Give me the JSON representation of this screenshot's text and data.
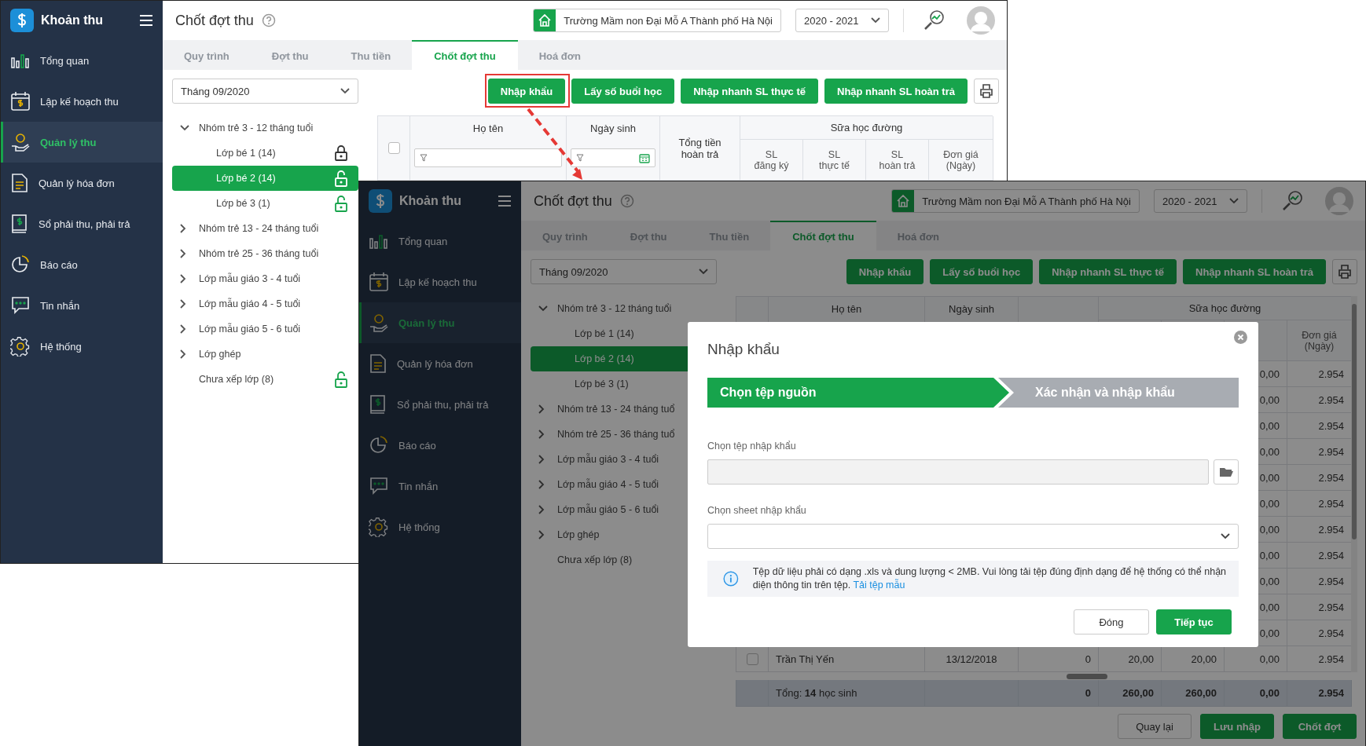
{
  "back_screen": {
    "app_name": "Khoản thu",
    "sidebar": [
      {
        "label": "Tổng quan",
        "selected": false
      },
      {
        "label": "Lập kế hoạch thu",
        "selected": false
      },
      {
        "label": "Quản lý thu",
        "selected": true
      },
      {
        "label": "Quản lý hóa đơn",
        "selected": false
      },
      {
        "label": "Sổ phải thu, phải trả",
        "selected": false
      },
      {
        "label": "Báo cáo",
        "selected": false
      },
      {
        "label": "Tin nhắn",
        "selected": false
      },
      {
        "label": "Hệ thống",
        "selected": false
      }
    ],
    "header": {
      "title": "Chốt đợt thu",
      "school": "Trường Mầm non Đại Mỗ A Thành phố Hà Nội",
      "year": "2020 - 2021"
    },
    "tabs": [
      {
        "label": "Quy trình",
        "selected": false
      },
      {
        "label": "Đợt thu",
        "selected": false
      },
      {
        "label": "Thu tiền",
        "selected": false
      },
      {
        "label": "Chốt đợt thu",
        "selected": true
      },
      {
        "label": "Hoá đơn",
        "selected": false
      }
    ],
    "month_select": "Tháng 09/2020",
    "toolbar_buttons": [
      "Nhập khẩu",
      "Lấy số buổi học",
      "Nhập nhanh SL thực tế",
      "Nhập nhanh SL hoàn trả"
    ],
    "tree": [
      {
        "label": "Nhóm trẻ 3 - 12 tháng tuổi",
        "expanded": true,
        "selected": false,
        "children": [
          {
            "label": "Lớp bé 1 (14)",
            "selected": false,
            "locked": true
          },
          {
            "label": "Lớp bé 2 (14)",
            "selected": true,
            "locked": false
          },
          {
            "label": "Lớp bé 3 (1)",
            "selected": false,
            "locked": false
          }
        ]
      },
      {
        "label": "Nhóm trẻ 13 - 24 tháng tuổi",
        "expanded": false,
        "selected": false
      },
      {
        "label": "Nhóm trẻ 25 - 36 tháng tuổi",
        "expanded": false,
        "selected": false
      },
      {
        "label": "Lớp mẫu giáo 3 - 4 tuổi",
        "expanded": false,
        "selected": false
      },
      {
        "label": "Lớp mẫu giáo 4 - 5 tuổi",
        "expanded": false,
        "selected": false
      },
      {
        "label": "Lớp mẫu giáo 5 - 6 tuổi",
        "expanded": false,
        "selected": false
      },
      {
        "label": "Lớp ghép",
        "expanded": false,
        "selected": false
      },
      {
        "label": "Chưa xếp lớp (8)",
        "selected": false,
        "locked": false
      }
    ],
    "table": {
      "select_all": {
        "checked": false
      },
      "filter_row": true,
      "header": {
        "ho_ten": "Họ tên",
        "ngay_sinh": "Ngày sinh",
        "tong_tien": "Tổng tiền\nhoàn trả",
        "group": "Sữa học đường",
        "sl_dang_ky": "SL\nđăng ký",
        "sl_thuc_te": "SL\nthực tế",
        "sl_hoan_tra": "SL\nhoàn trả",
        "don_gia": "Đơn giá\n(Ngày)"
      }
    }
  },
  "front_screen": {
    "app_name": "Khoản thu",
    "sidebar": [
      {
        "label": "Tổng quan",
        "selected": false
      },
      {
        "label": "Lập kế hoạch thu",
        "selected": false
      },
      {
        "label": "Quản lý thu",
        "selected": true
      },
      {
        "label": "Quản lý hóa đơn",
        "selected": false
      },
      {
        "label": "Sổ phải thu, phải trả",
        "selected": false
      },
      {
        "label": "Báo cáo",
        "selected": false
      },
      {
        "label": "Tin nhắn",
        "selected": false
      },
      {
        "label": "Hệ thống",
        "selected": false
      }
    ],
    "header": {
      "title": "Chốt đợt thu",
      "school": "Trường Mầm non Đại Mỗ A Thành phố Hà Nội",
      "year": "2020 - 2021"
    },
    "tabs": [
      {
        "label": "Quy trình",
        "selected": false
      },
      {
        "label": "Đợt thu",
        "selected": false
      },
      {
        "label": "Thu tiền",
        "selected": false
      },
      {
        "label": "Chốt đợt thu",
        "selected": true
      },
      {
        "label": "Hoá đơn",
        "selected": false
      }
    ],
    "month_select": "Tháng 09/2020",
    "toolbar_buttons": [
      "Nhập khẩu",
      "Lấy số buổi học",
      "Nhập nhanh SL thực tế",
      "Nhập nhanh SL hoàn trả"
    ],
    "tree": [
      {
        "label": "Nhóm trẻ 3 - 12 tháng tuổi",
        "expanded": true,
        "selected": false,
        "children": [
          {
            "label": "Lớp bé 1 (14)",
            "selected": false
          },
          {
            "label": "Lớp bé 2 (14)",
            "selected": true
          },
          {
            "label": "Lớp bé 3 (1)",
            "selected": false
          }
        ]
      },
      {
        "label": "Nhóm trẻ 13 - 24 tháng tuổ",
        "expanded": false,
        "selected": false
      },
      {
        "label": "Nhóm trẻ 25 - 36 tháng tuổ",
        "expanded": false,
        "selected": false
      },
      {
        "label": "Lớp mẫu giáo 3 - 4 tuổi",
        "expanded": false,
        "selected": false
      },
      {
        "label": "Lớp mẫu giáo 4 - 5 tuổi",
        "expanded": false,
        "selected": false
      },
      {
        "label": "Lớp mẫu giáo 5 - 6 tuổi",
        "expanded": false,
        "selected": false
      },
      {
        "label": "Lớp ghép",
        "expanded": false,
        "selected": false
      },
      {
        "label": "Chưa xếp lớp (8)",
        "selected": false
      }
    ],
    "table": {
      "header": {
        "ho_ten": "Họ tên",
        "ngay_sinh": "Ngày sinh",
        "group": "Sữa học đường",
        "don_gia": "Đơn giá\n(Ngày)"
      },
      "rows": [
        {
          "sl_hoan_tra": "0,00",
          "don_gia": "2.954"
        },
        {
          "sl_hoan_tra": "0,00",
          "don_gia": "2.954"
        },
        {
          "sl_hoan_tra": "0,00",
          "don_gia": "2.954"
        },
        {
          "sl_hoan_tra": "0,00",
          "don_gia": "2.954"
        },
        {
          "sl_hoan_tra": "0,00",
          "don_gia": "2.954"
        },
        {
          "sl_hoan_tra": "0,00",
          "don_gia": "2.954"
        },
        {
          "sl_hoan_tra": "0,00",
          "don_gia": "2.954"
        },
        {
          "sl_hoan_tra": "0,00",
          "don_gia": "2.954"
        },
        {
          "sl_hoan_tra": "0,00",
          "don_gia": "2.954"
        },
        {
          "sl_hoan_tra": "0,00",
          "don_gia": "2.954"
        },
        {
          "sl_hoan_tra": "0,00",
          "don_gia": "2.954"
        },
        {
          "checked": false,
          "ho_ten": "Trần Thị Yến",
          "ngay_sinh": "13/12/2018",
          "tong_tien": "0",
          "sl_dang_ky": "20,00",
          "sl_thuc_te": "20,00",
          "sl_hoan_tra": "0,00",
          "don_gia": "2.954"
        }
      ],
      "footer": {
        "label": "Tổng: **14** học sinh",
        "tong_tien": "0",
        "sl_dang_ky": "260,00",
        "sl_thuc_te": "260,00",
        "sl_hoan_tra": "0,00",
        "don_gia": "2.954"
      }
    },
    "bottom_buttons": [
      {
        "label": "Quay lại",
        "kind": "secondary"
      },
      {
        "label": "Lưu nhập",
        "kind": "primary"
      },
      {
        "label": "Chốt đợt",
        "kind": "primary"
      }
    ],
    "modal": {
      "title": "Nhập khẩu",
      "steps": [
        {
          "label": "Chọn tệp nguồn",
          "selected": true
        },
        {
          "label": "Xác nhận và nhập khẩu",
          "selected": false
        }
      ],
      "file_label": "Chọn tệp nhập khẩu",
      "sheet_label": "Chọn sheet nhập khẩu",
      "info": {
        "text": "Tệp dữ liệu phải có dạng .xls và dung lượng < 2MB. Vui lòng tải tệp đúng định dạng để hệ thống có thể nhận diện thông tin trên tệp.",
        "link": "Tải tệp mẫu"
      },
      "buttons": [
        {
          "label": "Đóng",
          "kind": "secondary"
        },
        {
          "label": "Tiếp tục",
          "kind": "primary"
        }
      ]
    }
  }
}
